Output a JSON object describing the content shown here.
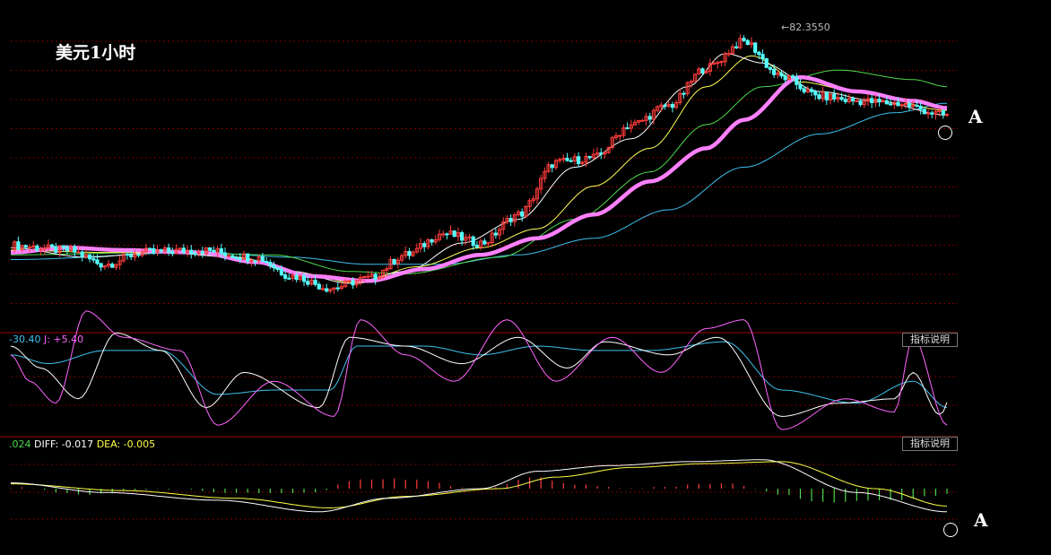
{
  "title": "美元1小时",
  "colors": {
    "up": "#ff3c3c",
    "down": "#54ffff",
    "bg": "#000000",
    "grid": "#7a0000",
    "ma_main": "#ff80ff",
    "ma_white": "#ffffff",
    "ma_yellow": "#ffff55",
    "ma_green": "#4cd94c",
    "ma_blue": "#3fc0ee",
    "dif": "#ffffff",
    "dea": "#ffff44",
    "k": "#ffffff",
    "d": "#ffff55",
    "j": "#ff66ff"
  },
  "price_panel": {
    "peak_label": "82.3550",
    "marker_label": "A"
  },
  "kdj_panel": {
    "info_d": "-30.40",
    "info_j": "J: +5.40",
    "help_label": "指标说明"
  },
  "macd_panel": {
    "info_macd": ".024",
    "info_diff": "DIFF: -0.017",
    "info_dea": "DEA: -0.005",
    "help_label": "指标说明",
    "marker_label": "A"
  },
  "chart_data": {
    "type": "candlestick",
    "anchors": {
      "close": [
        [
          0,
          77.95
        ],
        [
          15,
          77.85
        ],
        [
          25,
          77.55
        ],
        [
          35,
          77.8
        ],
        [
          50,
          77.85
        ],
        [
          65,
          77.7
        ],
        [
          75,
          77.3
        ],
        [
          85,
          77.05
        ],
        [
          95,
          77.25
        ],
        [
          105,
          77.75
        ],
        [
          115,
          78.2
        ],
        [
          125,
          78.0
        ],
        [
          135,
          78.6
        ],
        [
          145,
          79.7
        ],
        [
          155,
          79.8
        ],
        [
          165,
          80.5
        ],
        [
          175,
          80.9
        ],
        [
          185,
          81.7
        ],
        [
          195,
          82.25
        ],
        [
          205,
          81.5
        ],
        [
          215,
          81.1
        ],
        [
          225,
          81.0
        ],
        [
          235,
          80.95
        ],
        [
          249,
          80.7
        ]
      ],
      "ma_thick": [
        [
          0,
          77.8
        ],
        [
          15,
          77.9
        ],
        [
          30,
          77.85
        ],
        [
          50,
          77.8
        ],
        [
          65,
          77.6
        ],
        [
          80,
          77.3
        ],
        [
          95,
          77.2
        ],
        [
          110,
          77.45
        ],
        [
          125,
          77.75
        ],
        [
          140,
          78.1
        ],
        [
          155,
          78.6
        ],
        [
          170,
          79.3
        ],
        [
          185,
          80.0
        ],
        [
          195,
          80.6
        ],
        [
          210,
          81.5
        ],
        [
          225,
          81.2
        ],
        [
          240,
          81.0
        ],
        [
          249,
          80.85
        ]
      ],
      "ma_white": [
        [
          0,
          77.9
        ],
        [
          20,
          77.7
        ],
        [
          40,
          77.8
        ],
        [
          60,
          77.7
        ],
        [
          75,
          77.4
        ],
        [
          90,
          77.15
        ],
        [
          105,
          77.4
        ],
        [
          120,
          78.0
        ],
        [
          135,
          78.5
        ],
        [
          150,
          79.6
        ],
        [
          165,
          80.2
        ],
        [
          180,
          81.3
        ],
        [
          190,
          82.0
        ],
        [
          200,
          81.8
        ],
        [
          215,
          81.2
        ],
        [
          230,
          81.0
        ],
        [
          249,
          80.7
        ]
      ],
      "ma_yellow": [
        [
          0,
          77.85
        ],
        [
          25,
          77.8
        ],
        [
          45,
          77.8
        ],
        [
          60,
          77.7
        ],
        [
          78,
          77.35
        ],
        [
          92,
          77.15
        ],
        [
          108,
          77.5
        ],
        [
          125,
          77.9
        ],
        [
          140,
          78.3
        ],
        [
          155,
          79.2
        ],
        [
          170,
          80.0
        ],
        [
          185,
          81.3
        ],
        [
          197,
          81.95
        ],
        [
          210,
          81.4
        ],
        [
          225,
          81.2
        ],
        [
          249,
          80.8
        ]
      ],
      "ma_green": [
        [
          0,
          77.75
        ],
        [
          40,
          77.8
        ],
        [
          70,
          77.75
        ],
        [
          90,
          77.4
        ],
        [
          105,
          77.35
        ],
        [
          130,
          77.7
        ],
        [
          150,
          78.5
        ],
        [
          170,
          79.5
        ],
        [
          185,
          80.5
        ],
        [
          200,
          81.3
        ],
        [
          220,
          81.65
        ],
        [
          240,
          81.45
        ],
        [
          249,
          81.3
        ]
      ],
      "ma_blue": [
        [
          0,
          77.65
        ],
        [
          50,
          77.8
        ],
        [
          75,
          77.7
        ],
        [
          95,
          77.55
        ],
        [
          115,
          77.55
        ],
        [
          135,
          77.75
        ],
        [
          155,
          78.1
        ],
        [
          175,
          78.7
        ],
        [
          195,
          79.6
        ],
        [
          215,
          80.3
        ],
        [
          235,
          80.75
        ],
        [
          249,
          80.95
        ]
      ],
      "k": [
        [
          0,
          0
        ],
        [
          8,
          -25
        ],
        [
          18,
          -60
        ],
        [
          28,
          15
        ],
        [
          40,
          -5
        ],
        [
          52,
          -70
        ],
        [
          62,
          -30
        ],
        [
          82,
          -70
        ],
        [
          90,
          10
        ],
        [
          105,
          0
        ],
        [
          120,
          -20
        ],
        [
          135,
          10
        ],
        [
          148,
          -25
        ],
        [
          158,
          5
        ],
        [
          175,
          -10
        ],
        [
          188,
          10
        ],
        [
          205,
          -80
        ],
        [
          220,
          -65
        ],
        [
          235,
          -60
        ],
        [
          240,
          -30
        ],
        [
          247,
          -78
        ]
      ],
      "d": [
        [
          0,
          -10
        ],
        [
          10,
          -20
        ],
        [
          25,
          -5
        ],
        [
          40,
          -5
        ],
        [
          55,
          -55
        ],
        [
          70,
          -50
        ],
        [
          85,
          -50
        ],
        [
          92,
          0
        ],
        [
          110,
          0
        ],
        [
          125,
          -10
        ],
        [
          140,
          0
        ],
        [
          155,
          -5
        ],
        [
          170,
          -5
        ],
        [
          190,
          5
        ],
        [
          205,
          -50
        ],
        [
          225,
          -65
        ],
        [
          240,
          -40
        ],
        [
          249,
          -70
        ]
      ],
      "j": [
        [
          0,
          -10
        ],
        [
          5,
          -40
        ],
        [
          12,
          -65
        ],
        [
          20,
          40
        ],
        [
          30,
          10
        ],
        [
          45,
          -5
        ],
        [
          55,
          -90
        ],
        [
          70,
          -40
        ],
        [
          86,
          -80
        ],
        [
          93,
          30
        ],
        [
          105,
          -10
        ],
        [
          118,
          -40
        ],
        [
          132,
          30
        ],
        [
          145,
          -40
        ],
        [
          160,
          10
        ],
        [
          173,
          -30
        ],
        [
          185,
          20
        ],
        [
          195,
          30
        ],
        [
          205,
          -95
        ],
        [
          222,
          -60
        ],
        [
          235,
          -75
        ],
        [
          240,
          10
        ],
        [
          249,
          -90
        ]
      ],
      "dif": [
        [
          0,
          0.03
        ],
        [
          25,
          -0.02
        ],
        [
          55,
          -0.06
        ],
        [
          82,
          -0.12
        ],
        [
          100,
          -0.05
        ],
        [
          125,
          0
        ],
        [
          140,
          0.09
        ],
        [
          160,
          0.12
        ],
        [
          180,
          0.14
        ],
        [
          200,
          0.15
        ],
        [
          225,
          -0.02
        ],
        [
          249,
          -0.12
        ]
      ],
      "dea": [
        [
          0,
          0.025
        ],
        [
          30,
          -0.01
        ],
        [
          60,
          -0.05
        ],
        [
          85,
          -0.1
        ],
        [
          105,
          -0.04
        ],
        [
          130,
          0.0
        ],
        [
          145,
          0.06
        ],
        [
          165,
          0.11
        ],
        [
          185,
          0.13
        ],
        [
          205,
          0.14
        ],
        [
          230,
          0.0
        ],
        [
          249,
          -0.09
        ]
      ],
      "macd_bar": [
        [
          0,
          0.005
        ],
        [
          20,
          -0.03
        ],
        [
          40,
          0.0
        ],
        [
          60,
          -0.02
        ],
        [
          80,
          -0.02
        ],
        [
          93,
          0.05
        ],
        [
          105,
          0.05
        ],
        [
          125,
          0.0
        ],
        [
          140,
          0.06
        ],
        [
          150,
          0.02
        ],
        [
          165,
          0.0
        ],
        [
          190,
          0.03
        ],
        [
          205,
          -0.03
        ],
        [
          215,
          -0.07
        ],
        [
          235,
          -0.06
        ],
        [
          249,
          -0.03
        ]
      ]
    },
    "price_ylim": [
      76.6,
      82.6
    ],
    "kdj_ylim": [
      -100,
      0
    ],
    "macd_ylim": [
      -0.2,
      0.2
    ],
    "bar_count": 250,
    "peak_value": 82.355
  }
}
